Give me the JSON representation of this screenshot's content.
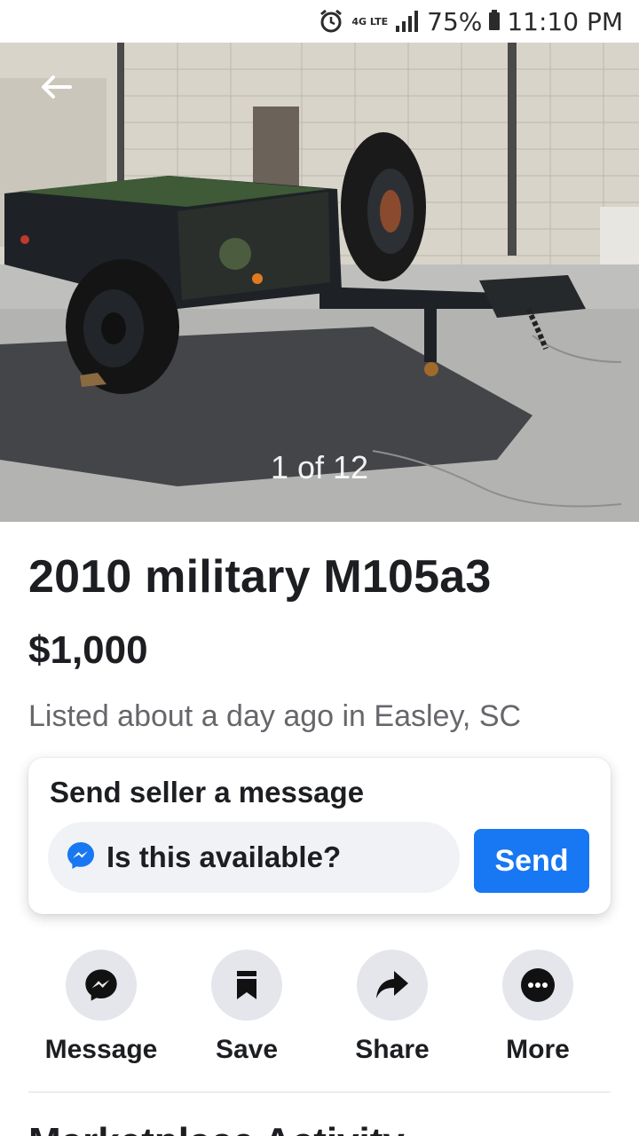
{
  "status_bar": {
    "network": "4G LTE",
    "battery": "75%",
    "time": "11:10 PM"
  },
  "photo": {
    "counter": "1 of 12"
  },
  "listing": {
    "title": "2010 military M105a3",
    "price": "$1,000",
    "listed": "Listed about a day ago in Easley, SC"
  },
  "message_card": {
    "heading": "Send seller a message",
    "input_value": "Is this available?",
    "send_label": "Send"
  },
  "actions": [
    {
      "label": "Message",
      "icon": "messenger-icon"
    },
    {
      "label": "Save",
      "icon": "bookmark-icon"
    },
    {
      "label": "Share",
      "icon": "share-arrow-icon"
    },
    {
      "label": "More",
      "icon": "more-dots-icon"
    }
  ],
  "next_section": {
    "title": "Marketplace Activity"
  },
  "colors": {
    "accent": "#1877f2",
    "text": "#1c1e21",
    "secondary_text": "#65676b",
    "chip_bg": "#e4e6eb"
  }
}
